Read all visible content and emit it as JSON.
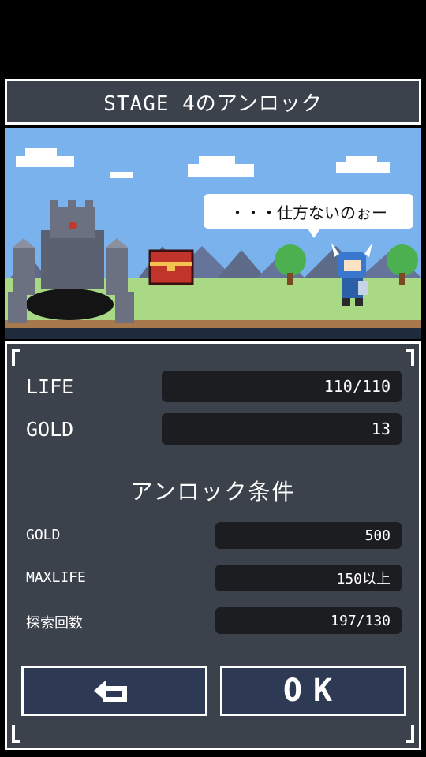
{
  "header": {
    "title": "STAGE 4のアンロック"
  },
  "scene": {
    "speech": "・・・仕方ないのぉー"
  },
  "stats": [
    {
      "label": "LIFE",
      "value": "110/110"
    },
    {
      "label": "GOLD",
      "value": "13"
    }
  ],
  "unlock": {
    "title": "アンロック条件",
    "conditions": [
      {
        "label": "GOLD",
        "value": "500"
      },
      {
        "label": "MAXLIFE",
        "value": "150以上"
      },
      {
        "label": "探索回数",
        "value": "197/130"
      }
    ]
  },
  "buttons": {
    "back_icon": "back-arrow-icon",
    "ok_label": "OK"
  }
}
